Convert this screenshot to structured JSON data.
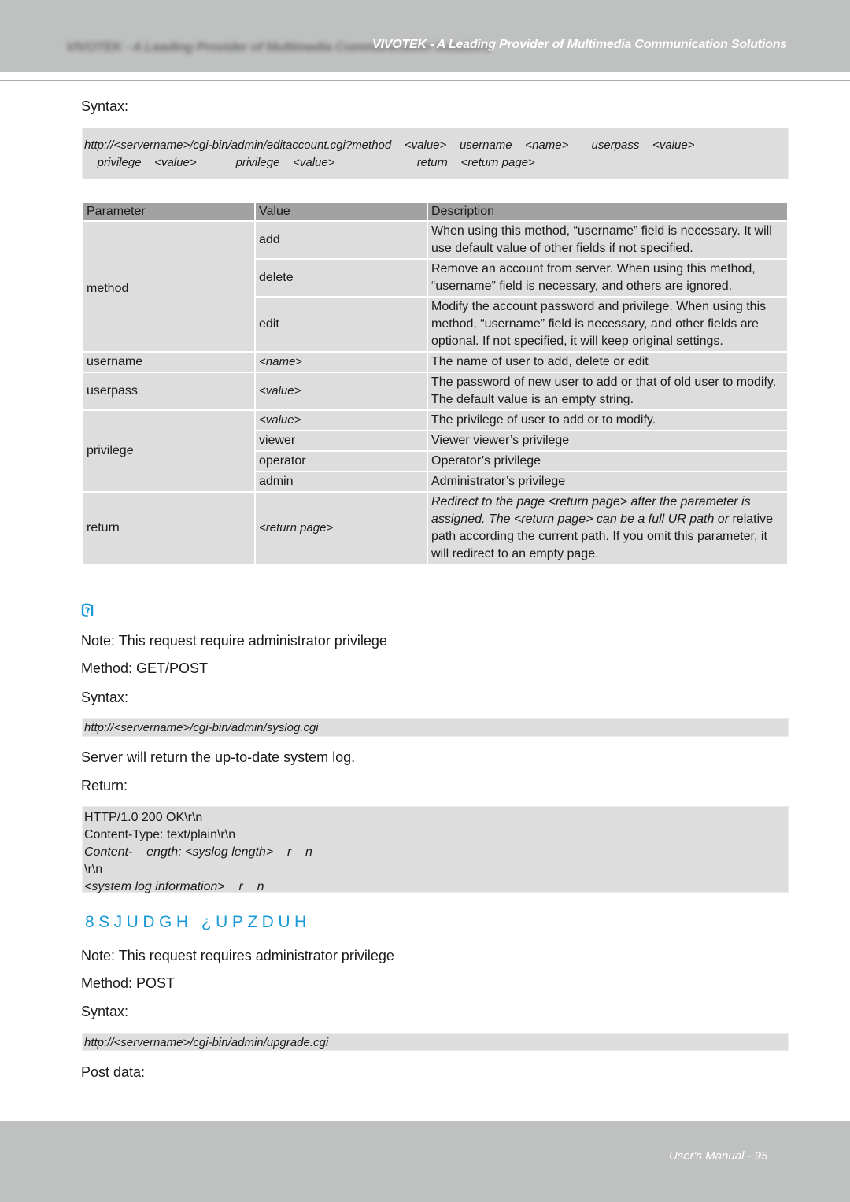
{
  "header": {
    "title": "VIVOTEK - A Leading Provider of Multimedia Communication Solutions",
    "ghost_title": "VIVOTEK - A Leading Provider of Multimedia Communication Solutions"
  },
  "editaccount": {
    "syntax_label": "Syntax:",
    "syntax_lines": [
      "http://<servername>/cgi-bin/admin/editaccount.cgi?method    <value>    username    <name>       userpass    <value>",
      "    privilege    <value>            privilege    <value>                         return    <return page>"
    ],
    "table": {
      "headers": [
        "Parameter",
        "Value",
        "Description"
      ],
      "groups": [
        {
          "parameter": "method",
          "rows": [
            {
              "value": "add",
              "description": "When using this method, “username” field is necessary. It will use default value of other fields if not specified."
            },
            {
              "value": "delete",
              "description": "Remove an account from server. When using this method, “username” field is necessary, and others are ignored."
            },
            {
              "value": "edit",
              "description": "Modify the account password and privilege. When using this method, “username” field is necessary, and other fields are optional. If not specified, it will keep original settings."
            }
          ]
        },
        {
          "parameter": "username",
          "rows": [
            {
              "value": "<name>",
              "description": "The name of user to add, delete or edit"
            }
          ]
        },
        {
          "parameter": "userpass",
          "rows": [
            {
              "value": "<value>",
              "description": "The password of new user to add or that of old user to modify. The default value is an empty string."
            }
          ]
        },
        {
          "parameter": "privilege",
          "rows": [
            {
              "value": "<value>",
              "description": "The privilege of user to add or to modify."
            },
            {
              "value": "viewer",
              "description": "Viewer  viewer’s privilege"
            },
            {
              "value": "operator",
              "description": "Operator’s privilege"
            },
            {
              "value": "admin",
              "description": "Administrator’s privilege"
            }
          ]
        },
        {
          "parameter": "return",
          "rows": [
            {
              "value": "<return page>",
              "description_italic": "Redirect to the page <return page> after the parameter is assigned. The <return page> can be a full UR    path or",
              "description": "relative path according the current path. If you omit this parameter, it will redirect to an empty page."
            }
          ]
        }
      ]
    }
  },
  "syslog": {
    "icon": "document-glyph-icon",
    "note": "Note: This request require administrator privilege",
    "method": "Method: GET/POST",
    "syntax_label": "Syntax:",
    "syntax": "http://<servername>/cgi-bin/admin/syslog.cgi",
    "description": "Server will return the up-to-date system log.",
    "return_label": "Return:",
    "return_lines": [
      {
        "text": "HTTP/1.0 200 OK\\r\\n",
        "italic": false
      },
      {
        "text": "Content-Type: text/plain\\r\\n",
        "italic": false
      },
      {
        "text": "Content-    ength: <syslog length>    r    n",
        "italic": true
      },
      {
        "text": "\\r\\n",
        "italic": false
      },
      {
        "text": "<system log information>    r    n",
        "italic": true
      }
    ]
  },
  "upgrade": {
    "title": "8SJUDGH ¿UPZDUH",
    "note": "Note: This request requires administrator privilege",
    "method": "Method: POST",
    "syntax_label": "Syntax:",
    "syntax": "http://<servername>/cgi-bin/admin/upgrade.cgi",
    "post_data_label": "Post data:"
  },
  "footer": {
    "page_label": "User's Manual - 95"
  }
}
